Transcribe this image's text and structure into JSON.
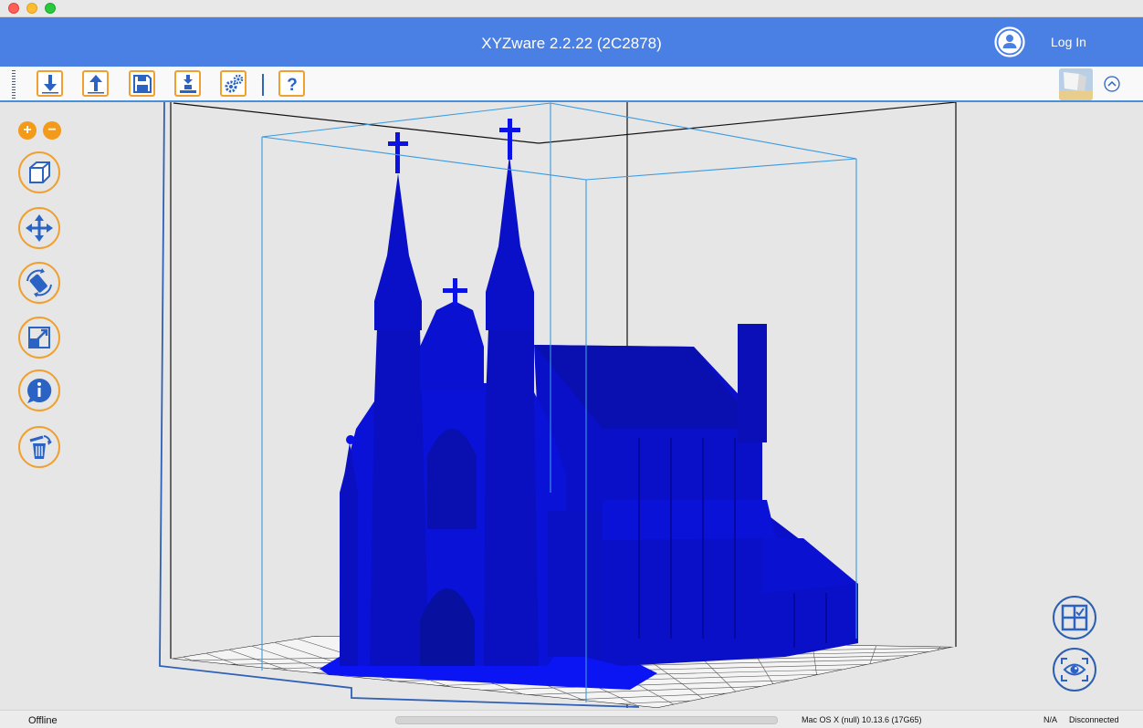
{
  "window": {
    "title": "XYZware 2.2.22 (2C2878)",
    "traffic_lights": [
      "close",
      "minimize",
      "zoom"
    ]
  },
  "header": {
    "login_label": "Log In",
    "user_icon": "user-circle-icon",
    "background": "#4a7fe3"
  },
  "toolbar": {
    "buttons": [
      {
        "name": "import-button",
        "icon": "download-arrow-icon"
      },
      {
        "name": "export-button",
        "icon": "upload-arrow-icon"
      },
      {
        "name": "save-button",
        "icon": "floppy-disk-icon"
      },
      {
        "name": "print-button",
        "icon": "printer-platform-icon"
      },
      {
        "name": "settings-button",
        "icon": "gears-icon"
      },
      {
        "name": "help-button",
        "icon": "question-mark-icon"
      }
    ],
    "accent": "#f0a030"
  },
  "sidebar": {
    "zoom_in": "+",
    "zoom_out": "−",
    "tools": [
      "view-cube-icon",
      "move-icon",
      "rotate-icon",
      "scale-icon",
      "info-icon",
      "delete-icon"
    ]
  },
  "viewport": {
    "model_color": "#0a12e6",
    "view_buttons": [
      "layout-grid-icon",
      "eye-view-icon"
    ]
  },
  "status": {
    "connection": "Offline",
    "os": "Mac OS X (null) 10.13.6 (17G65)",
    "na": "N/A",
    "device": "Disconnected"
  }
}
